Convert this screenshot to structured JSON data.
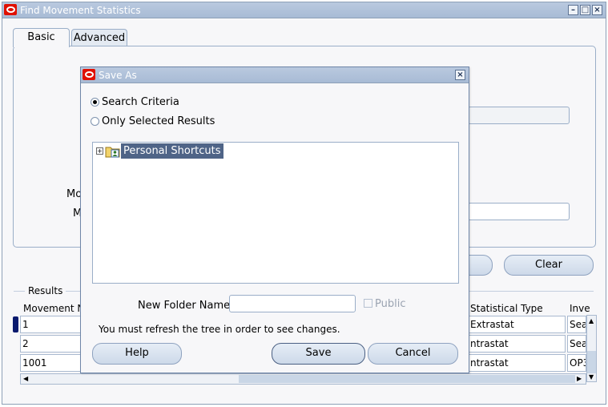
{
  "window": {
    "title": "Find Movement Statistics",
    "controls": [
      "minimize-icon",
      "maximize-icon",
      "close-icon"
    ]
  },
  "tabs": [
    {
      "label": "Basic",
      "active": true
    },
    {
      "label": "Advanced",
      "active": false
    }
  ],
  "form": {
    "partial_label_1": "Mo",
    "partial_label_2": "M"
  },
  "buttons": {
    "clear": "Clear"
  },
  "results": {
    "label": "Results",
    "columns": [
      "Movement N",
      "Statistical Type",
      "Inve"
    ],
    "rows": [
      {
        "movement": "1",
        "stat_type": "Extrastat",
        "inv": "Sea"
      },
      {
        "movement": "2",
        "stat_type": "ntrastat",
        "inv": "Sea"
      },
      {
        "movement": "1001",
        "stat_type": "ntrastat",
        "inv": "OP3"
      }
    ]
  },
  "dialog": {
    "title": "Save As",
    "radio_search_criteria": "Search Criteria",
    "radio_only_selected": "Only Selected Results",
    "tree_node": "Personal Shortcuts",
    "new_folder_label": "New Folder Name",
    "new_folder_value": "",
    "public_label": "Public",
    "refresh_note": "You must refresh the tree in order to see changes.",
    "help_button": "Help",
    "save_button": "Save",
    "cancel_button": "Cancel"
  },
  "colors": {
    "titlebar": "#a8bbd5",
    "oracle_red": "#e01000",
    "selection": "#4f6487",
    "border": "#9aaec8"
  }
}
